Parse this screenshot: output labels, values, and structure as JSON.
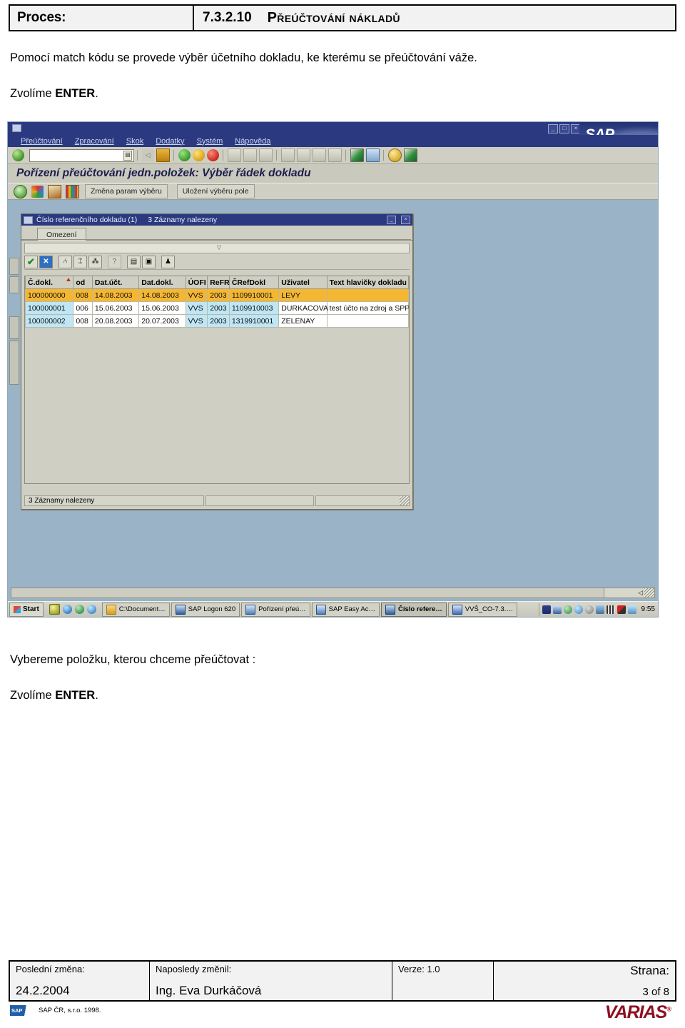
{
  "doc_header": {
    "label": "Proces:",
    "number": "7.3.2.10",
    "title": "Přeúčtování nákladů"
  },
  "paragraphs": {
    "intro": "Pomocí match kódu se provede výběr účetního dokladu, ke kterému se přeúčtování váže.",
    "enter_prefix": "Zvolíme ",
    "enter_key": "ENTER",
    "enter_suffix": ".",
    "select_item": "Vybereme položku, kterou chceme přeúčtovat :"
  },
  "sap": {
    "logo_text": "SAP",
    "menu": [
      "Přeúčtování",
      "Zpracování",
      "Skok",
      "Dodatky",
      "Systém",
      "Nápověda"
    ],
    "window_controls": [
      "_",
      "□",
      "×"
    ],
    "command_field_value": "",
    "screen_title": "Pořízení přeúčtování jedn.položek: Výběr řádek dokladu",
    "app_toolbar": {
      "icons": [
        "execute-icon",
        "multi-selection-icon",
        "data-source-icon",
        "color-stripes-icon"
      ],
      "buttons": [
        "Změna param výběru",
        "Uložení výběru pole"
      ]
    },
    "main_toolbar_icons": [
      "enter-check-icon",
      "save-icon",
      "back-icon",
      "exit-up-icon",
      "cancel-icon",
      "print-icon",
      "find-icon",
      "find-next-icon",
      "first-page-icon",
      "prev-page-icon",
      "next-page-icon",
      "last-page-icon",
      "create-session-icon",
      "shortcut-icon",
      "help-icon",
      "layout-menu-icon"
    ],
    "dialog": {
      "title": "Číslo referenčního dokladu (1)",
      "subtitle": "3 Záznamy nalezeny",
      "tab": "Omezení",
      "toolbar_icons": [
        "check-icon",
        "cancel-x-icon",
        "find-icon",
        "find-next-icon",
        "multiple-selection-icon",
        "help-icon",
        "print-icon",
        "save-icon",
        "settings-icon"
      ],
      "table": {
        "columns": [
          "Č.dokl.",
          "od",
          "Dat.účt.",
          "Dat.dokl.",
          "ÚOFI",
          "ReFR",
          "ČRefDokl",
          "Uživatel",
          "Text hlavičky dokladu"
        ],
        "sorted_column": "Č.dokl.",
        "rows": [
          {
            "selected": true,
            "cells": [
              "100000000",
              "008",
              "14.08.2003",
              "14.08.2003",
              "VVS",
              "2003",
              "1109910001",
              "LEVY",
              ""
            ]
          },
          {
            "selected": false,
            "cells": [
              "100000001",
              "006",
              "15.06.2003",
              "15.06.2003",
              "VVS",
              "2003",
              "1109910003",
              "DURKACOVA",
              "test účto na zdroj a SPP"
            ]
          },
          {
            "selected": false,
            "cells": [
              "100000002",
              "008",
              "20.08.2003",
              "20.07.2003",
              "VVS",
              "2003",
              "1319910001",
              "ZELENAY",
              ""
            ]
          }
        ]
      },
      "status": [
        "3 Záznamy nalezeny",
        "",
        ""
      ]
    },
    "taskbar": {
      "start": "Start",
      "quick_launch": [
        "shield-icon",
        "internet-explorer-icon",
        "media-player-icon",
        "refresh-icon"
      ],
      "tasks": [
        {
          "label": "C:\\Document…",
          "icon": "folder-icon",
          "active": false
        },
        {
          "label": "SAP Logon 620",
          "icon": "sap-logon-icon",
          "active": false
        },
        {
          "label": "Pořízení přeú…",
          "icon": "sap-gui-icon",
          "active": false
        },
        {
          "label": "SAP Easy Ac…",
          "icon": "sap-gui-icon",
          "active": false
        },
        {
          "label": "Číslo refere…",
          "icon": "sap-logon-icon",
          "active": true
        },
        {
          "label": "VVŠ_CO-7.3.…",
          "icon": "word-icon",
          "active": false
        }
      ],
      "tray_icons": [
        "sap-tray-icon",
        "sap-logon-tray-icon",
        "network-icon",
        "globe-icon",
        "clock-tray-icon",
        "security-icon",
        "keyboard-icon",
        "display-icon",
        "volume-icon"
      ],
      "clock": "9:55"
    }
  },
  "footer": {
    "last_change_label": "Poslední změna:",
    "last_change_value": "24.2.2004",
    "changed_by_label": "Naposledy změnil:",
    "changed_by_value": "Ing. Eva Durkáčová",
    "version_label": "Verze: 1.0",
    "version_value": "",
    "page_label": "Strana:",
    "page_value": "3 of 8",
    "sap_badge": "SAP",
    "sap_copyright": "SAP ČR, s.r.o. 1998.",
    "vendor": "VARIAS"
  },
  "colors": {
    "sap_blue": "#2b3a80",
    "sap_grey": "#cfcfc4",
    "desktop_blue": "#9ab3c7",
    "row_selected": "#f5b731",
    "row_key_cell": "#bfe6f5",
    "vendor_red": "#8e1020"
  }
}
